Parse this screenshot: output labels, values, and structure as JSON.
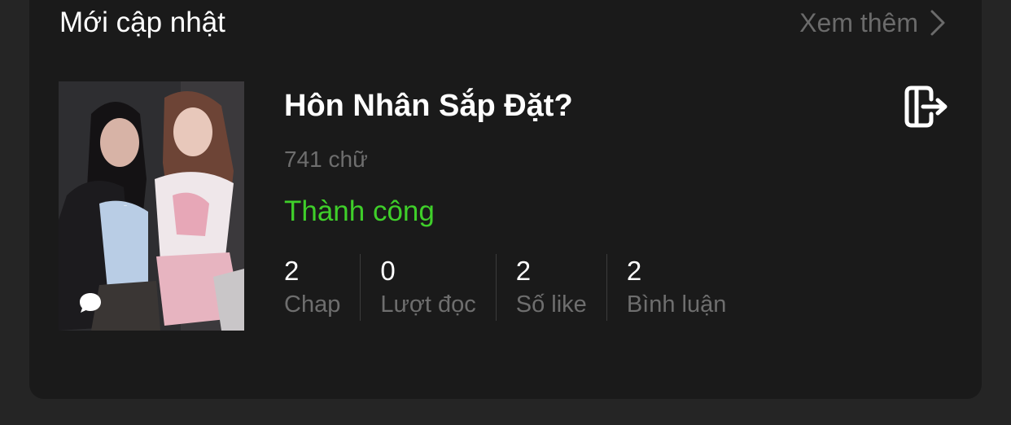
{
  "section": {
    "title": "Mới cập nhật",
    "see_more_label": "Xem thêm"
  },
  "book": {
    "title": "Hôn Nhân Sắp Đặt?",
    "word_count": "741 chữ",
    "status": "Thành công",
    "stats": [
      {
        "value": "2",
        "label": "Chap"
      },
      {
        "value": "0",
        "label": "Lượt đọc"
      },
      {
        "value": "2",
        "label": "Số like"
      },
      {
        "value": "2",
        "label": "Bình luận"
      }
    ]
  },
  "colors": {
    "background": "#252525",
    "card": "#1a1a1a",
    "status_success": "#3fcf2a",
    "muted_text": "#6e6e6e"
  },
  "icons": {
    "see_more": "chevron-right-icon",
    "export": "exit-door-icon",
    "cover_overlay": "chat-bubble-icon"
  }
}
